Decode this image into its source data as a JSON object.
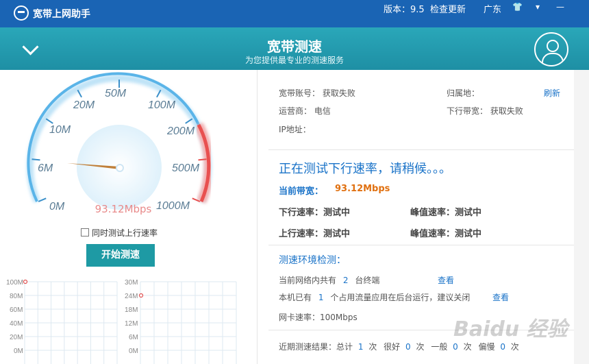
{
  "titlebar": {
    "app_name": "宽带上网助手",
    "version": "版本：9.5",
    "check_update": "检查更新",
    "region": "广东",
    "skin_icon": "shirt-icon",
    "menu_icon": "dropdown-icon",
    "minimize_icon": "minimize-icon"
  },
  "banner": {
    "title": "宽带测速",
    "subtitle": "为您提供最专业的测速服务"
  },
  "gauge": {
    "labels": [
      "0M",
      "6M",
      "10M",
      "20M",
      "50M",
      "100M",
      "200M",
      "500M",
      "1000M"
    ],
    "current_value": "93.12Mbps",
    "max_label": "1000M"
  },
  "controls": {
    "upload_test_checkbox": "同时测试上行速率",
    "upload_test_checked": false,
    "start_button": "开始测速"
  },
  "mini_charts": [
    {
      "ticks": [
        "100M",
        "80M",
        "60M",
        "40M",
        "20M",
        "0M"
      ],
      "value": 100
    },
    {
      "ticks": [
        "30M",
        "24M",
        "18M",
        "12M",
        "6M",
        "0M"
      ],
      "value": 24
    }
  ],
  "account_info": {
    "account_label": "宽带账号：",
    "account_value": "获取失败",
    "location_label": "归属地：",
    "refresh": "刷新",
    "isp_label": "运营商：",
    "isp_value": "电信",
    "downlink_bw_label": "下行带宽：",
    "downlink_bw_value": "获取失败",
    "ip_label": "IP地址："
  },
  "test_status": {
    "message": "正在测试下行速率，请稍候。。。",
    "current_bw_label": "当前带宽：",
    "current_bw_value": "93.12Mbps",
    "down_rate": "下行速率：测试中",
    "peak_rate_1": "峰值速率：测试中",
    "up_rate": "上行速率：测试中",
    "peak_rate_2": "峰值速率：测试中"
  },
  "environment": {
    "title": "测速环境检测：",
    "line1_prefix": "当前网络内共有",
    "line1_count": "2",
    "line1_suffix": "台终端",
    "line1_link": "查看",
    "line2_prefix": "本机已有",
    "line2_count": "1",
    "line2_suffix": "个占用流量应用在后台运行，建议关闭",
    "line2_link": "查看",
    "nic_speed": "网卡速率：100Mbps"
  },
  "recent_results": {
    "label": "近期测速结果：总计",
    "total": "1",
    "unit": "次",
    "good_label": "很好",
    "good": "0",
    "avg_label": "一般",
    "avg": "0",
    "slow_label": "偏慢",
    "slow": "0"
  },
  "watermark": "Baidu 经验",
  "colors": {
    "titlebar": "#1a64b4",
    "banner": "#2aa7b9",
    "accent_blue": "#1a73c8",
    "button": "#1e9aa4",
    "orange": "#e07010",
    "gauge_blue": "#5ab4e8",
    "gauge_red": "#e85050"
  }
}
